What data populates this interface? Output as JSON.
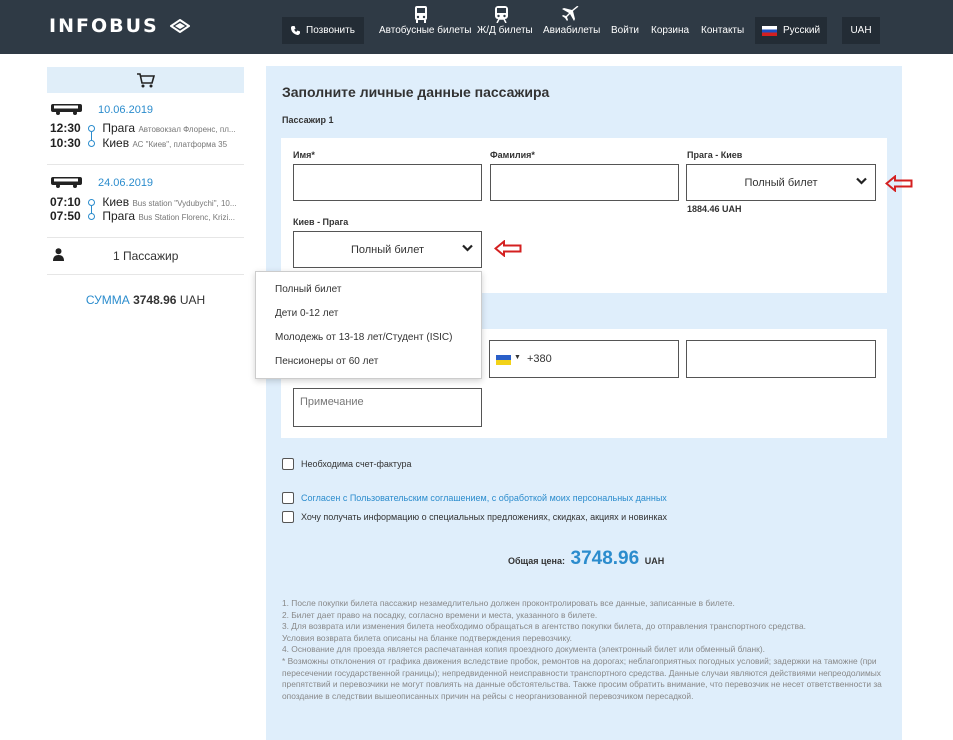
{
  "header": {
    "logo": "INFOBUS",
    "call_label": "Позвонить",
    "nav": [
      {
        "label": "Автобусные билеты",
        "icon": "bus-icon"
      },
      {
        "label": "Ж/Д билеты",
        "icon": "train-icon"
      },
      {
        "label": "Авиабилеты",
        "icon": "plane-icon"
      },
      {
        "label": "Войти"
      },
      {
        "label": "Корзина"
      },
      {
        "label": "Контакты"
      }
    ],
    "language": "Русский",
    "currency": "UAH"
  },
  "sidebar": {
    "trips": [
      {
        "date": "10.06.2019",
        "depart_time": "12:30",
        "depart_city": "Прага",
        "depart_stop": "Автовокзал Флоренс, пл...",
        "arrive_time": "10:30",
        "arrive_city": "Киев",
        "arrive_stop": "АС \"Киев\", платформа 35"
      },
      {
        "date": "24.06.2019",
        "depart_time": "07:10",
        "depart_city": "Киев",
        "depart_stop": "Bus station \"Vydubychi\", 10...",
        "arrive_time": "07:50",
        "arrive_city": "Прага",
        "arrive_stop": "Bus Station Florenc, Krizi..."
      }
    ],
    "passengers": "1 Пассажир",
    "sum_label": "СУММА",
    "sum_value": "3748.96",
    "sum_currency": "UAH"
  },
  "form": {
    "title": "Заполните личные данные пассажира",
    "passenger_heading": "Пассажир 1",
    "first_name_label": "Имя*",
    "last_name_label": "Фамилия*",
    "route1_label": "Прага - Киев",
    "route1_ticket": "Полный билет",
    "route1_price": "1884.46 UAH",
    "route2_label": "Киев - Прага",
    "route2_ticket": "Полный билет",
    "phone_code": "+380",
    "note_placeholder": "Примечание",
    "ticket_options": [
      "Полный билет",
      "Дети 0-12 лет",
      "Молодежь от 13-18 лет/Студент (ISIC)",
      "Пенсионеры от 60 лет"
    ],
    "checkboxes": {
      "invoice": "Необходима счет-фактура",
      "agree": "Согласен с Пользовательским соглашением, с обработкой моих персональных данных",
      "subscribe": "Хочу получать информацию о специальных предложениях, скидках, акциях и новинках"
    },
    "total_label": "Общая цена:",
    "total_value": "3748.96",
    "total_currency": "UAH",
    "notes": [
      "1. После покупки билета пассажир незамедлительно должен проконтролировать все данные, записанные в билете.",
      "2. Билет дает право на посадку, согласно времени и места, указанного в билете.",
      "3. Для возврата или изменения билета необходимо обращаться в агентство покупки билета, до отправления транспортного средства.",
      "Условия возврата билета описаны на бланке подтверждения перевозчику.",
      "4. Основание для проезда является распечатанная копия проездного документа (электронный билет или обменный бланк).",
      "* Возможны отклонения от графика движения вследствие пробок, ремонтов на дорогах; неблагоприятных погодных условий; задержки на таможне (при пересечении государственной границы); непредвиденной неисправности транспортного средства. Данные случаи являются действиями непреодолимых препятствий и перевозчики не могут повлиять на данные обстоятельства. Также просим обратить внимание, что перевозчик не несет ответственности за опоздание в следствии вышеописанных причин на рейсы с неорганизованной перевозчиком пересадкой."
    ]
  },
  "colors": {
    "header_bg": "#2f3a45",
    "accent": "#2b8ccd",
    "panel_bg": "#dfeefb",
    "arrow": "#d42020"
  }
}
